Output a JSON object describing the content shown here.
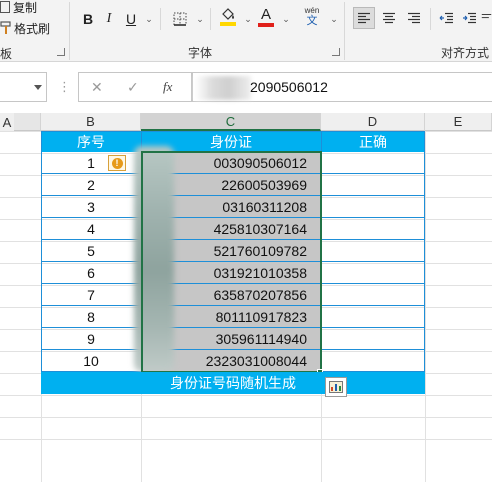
{
  "ribbon": {
    "clipboard": {
      "copy_label": "复制",
      "format_painter_label": "格式刷",
      "group_label_partial": "板"
    },
    "font": {
      "bold": "B",
      "italic": "I",
      "underline": "U",
      "underline_chevron": "⌄",
      "border_chevron": "⌄",
      "fill_chevron": "⌄",
      "font_color_letter": "A",
      "font_color_chevron": "⌄",
      "phonetic_top": "wén",
      "phonetic_bottom": "文",
      "phonetic_chevron": "⌄",
      "group_label": "字体",
      "accent_fill": "#ffd700",
      "accent_font": "#e0201a"
    },
    "alignment": {
      "group_label": "对齐方式"
    }
  },
  "formula_bar": {
    "name_box_value": "",
    "cancel_symbol": "✕",
    "enter_symbol": "✓",
    "fx_label": "fx",
    "dots": "⋮",
    "content_visible": "2090506012"
  },
  "sheet": {
    "columns": [
      "A",
      "B",
      "C",
      "D",
      "E"
    ],
    "selected_column": "C",
    "table": {
      "headers": [
        "序号",
        "身份证",
        "正确"
      ],
      "rows": [
        {
          "num": "1",
          "id": "003090506012"
        },
        {
          "num": "2",
          "id": "22600503969"
        },
        {
          "num": "3",
          "id": "03160311208"
        },
        {
          "num": "4",
          "id": "425810307164"
        },
        {
          "num": "5",
          "id": "521760109782"
        },
        {
          "num": "6",
          "id": "031921010358"
        },
        {
          "num": "7",
          "id": "635870207856"
        },
        {
          "num": "8",
          "id": "801110917823"
        },
        {
          "num": "9",
          "id": "305961114940"
        },
        {
          "num": "10",
          "id": "2323031008044"
        }
      ],
      "footer": "身份证号码随机生成"
    },
    "colors": {
      "header_fill": "#00b0f0",
      "border_blue": "#1e8fd8",
      "selection": "#c6c6c6",
      "header_text": "#ffffff"
    }
  }
}
